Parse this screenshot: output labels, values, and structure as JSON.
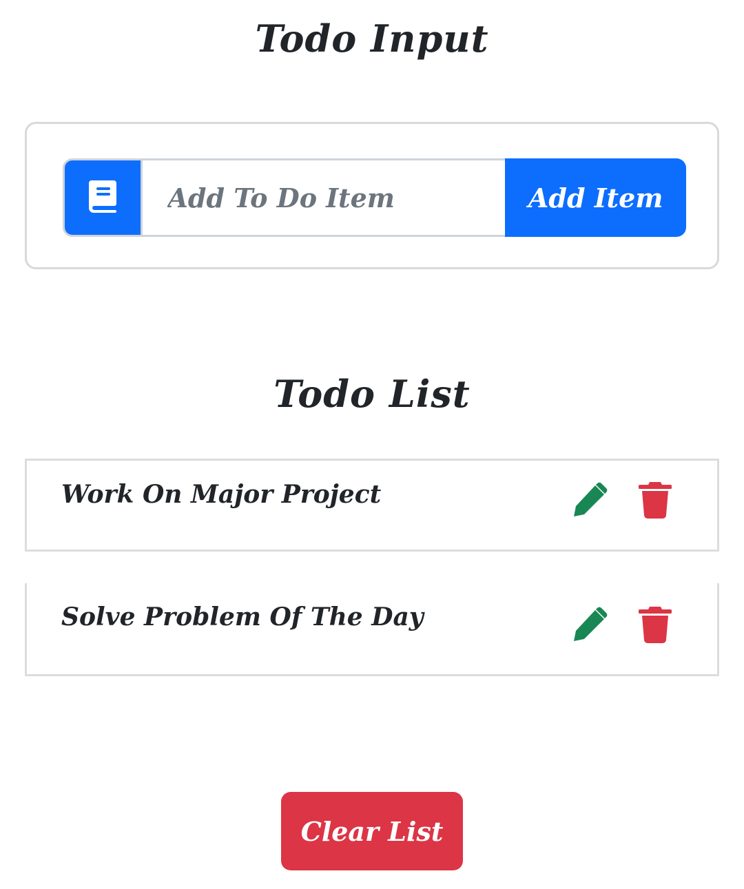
{
  "input_section": {
    "title": "Todo Input",
    "input": {
      "placeholder": "Add To Do Item",
      "value": ""
    },
    "addon_icon": "book-icon",
    "add_button_label": "Add Item"
  },
  "list_section": {
    "title": "Todo List",
    "items": [
      {
        "text": "Work On Major Project",
        "edit_icon": "pencil-icon",
        "delete_icon": "trash-icon"
      },
      {
        "text": "Solve Problem Of The Day",
        "edit_icon": "pencil-icon",
        "delete_icon": "trash-icon"
      }
    ],
    "clear_button_label": "Clear List"
  },
  "colors": {
    "primary": "#0d6efd",
    "danger": "#dc3545",
    "success": "#198754",
    "text": "#212529",
    "placeholder": "#6c757d"
  }
}
